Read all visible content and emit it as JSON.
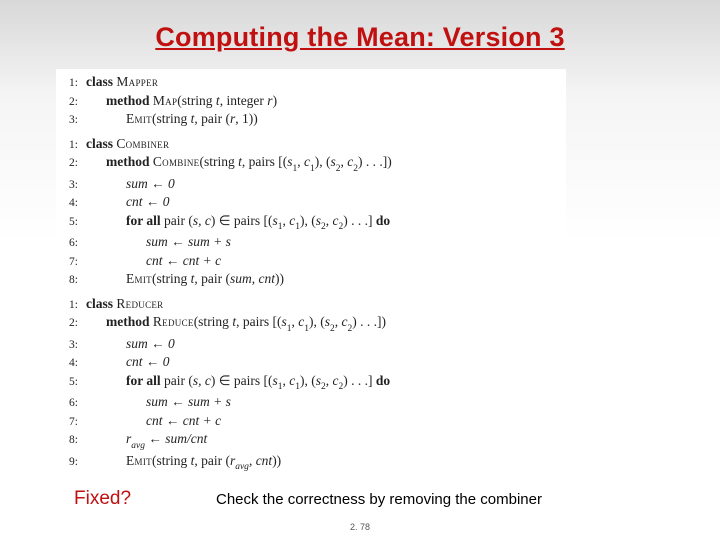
{
  "title": "Computing the Mean: Version 3",
  "fixed": "Fixed?",
  "check": "Check the correctness by removing the combiner",
  "pagenum": "2. 78",
  "watermark": "",
  "algo": {
    "mapper": {
      "l1": "class ",
      "l1b": "Mapper",
      "l2a": "method ",
      "l2b": "Map",
      "l2c": "(string ",
      "l2d": "t",
      "l2e": ", integer ",
      "l2f": "r",
      "l2g": ")",
      "l3a": "Emit",
      "l3b": "(string ",
      "l3c": "t",
      "l3d": ", pair (",
      "l3e": "r",
      "l3f": ", 1))"
    },
    "combiner": {
      "l1": "class ",
      "l1b": "Combiner",
      "l2a": "method ",
      "l2b": "Combine",
      "l2c": "(string ",
      "l2d": "t",
      "l2e": ", pairs [(",
      "l2f": "s",
      "l2g": "1",
      "l2h": ", ",
      "l2i": "c",
      "l2j": "1",
      "l2k": "), (",
      "l2l": "s",
      "l2m": "2",
      "l2n": ", ",
      "l2o": "c",
      "l2p": "2",
      "l2q": ") . . .])",
      "l3": "sum ← 0",
      "l4": "cnt ← 0",
      "l5a": "for all ",
      "l5b": "pair (",
      "l5c": "s, c",
      "l5d": ") ∈ pairs [(",
      "l5e": "s",
      "l5f": "1",
      "l5g": ", ",
      "l5h": "c",
      "l5i": "1",
      "l5j": "), (",
      "l5k": "s",
      "l5l": "2",
      "l5m": ", ",
      "l5n": "c",
      "l5o": "2",
      "l5p": ") . . .] ",
      "l5q": "do",
      "l6": "sum ← sum + s",
      "l7": "cnt ← cnt + c",
      "l8a": "Emit",
      "l8b": "(string ",
      "l8c": "t",
      "l8d": ", pair (",
      "l8e": "sum, cnt",
      "l8f": "))"
    },
    "reducer": {
      "l1": "class ",
      "l1b": "Reducer",
      "l2a": "method ",
      "l2b": "Reduce",
      "l2c": "(string ",
      "l2d": "t",
      "l2e": ", pairs [(",
      "l2f": "s",
      "l2g": "1",
      "l2h": ", ",
      "l2i": "c",
      "l2j": "1",
      "l2k": "), (",
      "l2l": "s",
      "l2m": "2",
      "l2n": ", ",
      "l2o": "c",
      "l2p": "2",
      "l2q": ") . . .])",
      "l3": "sum ← 0",
      "l4": "cnt ← 0",
      "l5a": "for all ",
      "l5b": "pair (",
      "l5c": "s, c",
      "l5d": ") ∈ pairs [(",
      "l5e": "s",
      "l5f": "1",
      "l5g": ", ",
      "l5h": "c",
      "l5i": "1",
      "l5j": "), (",
      "l5k": "s",
      "l5l": "2",
      "l5m": ", ",
      "l5n": "c",
      "l5o": "2",
      "l5p": ") . . .] ",
      "l5q": "do",
      "l6": "sum ← sum + s",
      "l7": "cnt ← cnt + c",
      "l8a": "r",
      "l8b": "avg",
      "l8c": " ← sum/cnt",
      "l9a": "Emit",
      "l9b": "(string ",
      "l9c": "t",
      "l9d": ", pair (",
      "l9e": "r",
      "l9f": "avg",
      "l9g": ", ",
      "l9h": "cnt",
      "l9i": "))"
    }
  }
}
